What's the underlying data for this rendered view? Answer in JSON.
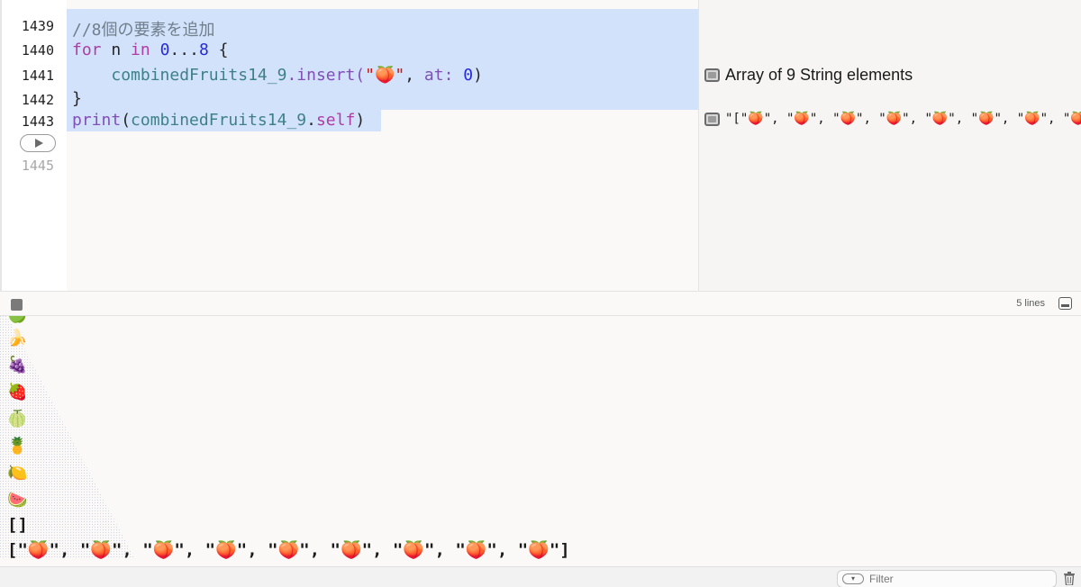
{
  "gutter": {
    "lines": [
      "1439",
      "1440",
      "1441",
      "1442",
      "1443",
      "1445"
    ]
  },
  "code": {
    "comment": "//8個の要素を追加",
    "for_kw": "for",
    "var_n": "n",
    "in_kw": "in",
    "range_start": "0",
    "range_op": "...",
    "range_end": "8",
    "brace_open": "{",
    "insert_ident": "combinedFruits14_9",
    "insert_method": ".insert(",
    "insert_str": "\"🍑\"",
    "insert_at": "at:",
    "insert_zero": "0",
    "insert_close": ")",
    "brace_close": "}",
    "print_fn": "print",
    "print_open": "(",
    "print_ident": "combinedFruits14_9",
    "print_dot": ".",
    "print_self": "self",
    "print_close": ")"
  },
  "results": {
    "row1": "Array of 9 String elements",
    "row2": "\"[\"🍑\", \"🍑\", \"🍑\", \"🍑\", \"🍑\", \"🍑\", \"🍑\", \"🍑\"..."
  },
  "console": {
    "line_count": "5 lines",
    "fruits": [
      "🍌",
      "🍇",
      "🍓",
      "🍈",
      "🍍",
      "🍋",
      "🍉"
    ],
    "empty_output": "[]",
    "array_output": "[\"🍑\", \"🍑\", \"🍑\", \"🍑\", \"🍑\", \"🍑\", \"🍑\", \"🍑\", \"🍑\"]"
  },
  "footer": {
    "filter_placeholder": "Filter"
  }
}
